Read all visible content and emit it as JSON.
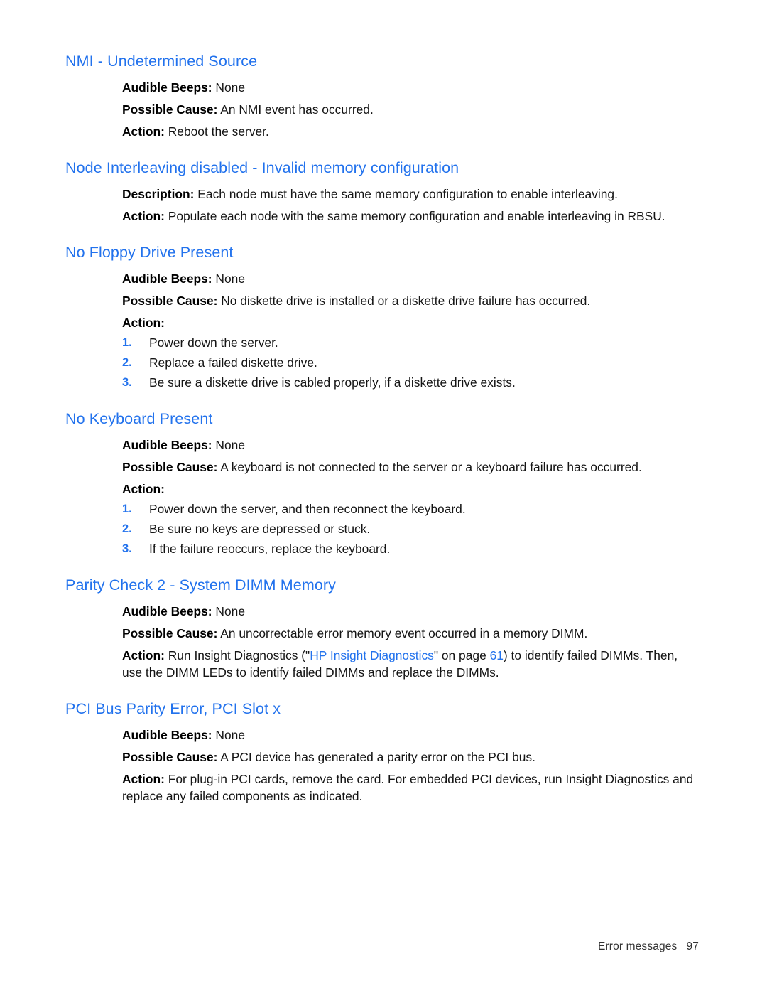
{
  "page": {
    "footer_label": "Error messages",
    "footer_page_number": "97",
    "heading_color": "#2272ED",
    "text_color": "#141414",
    "background_color": "#ffffff"
  },
  "labels": {
    "audible_beeps": "Audible Beeps",
    "possible_cause": "Possible Cause",
    "action": "Action",
    "description": "Description",
    "colon": ":"
  },
  "sections": [
    {
      "heading": "NMI - Undetermined Source",
      "audible_beeps_value": " None",
      "possible_cause_value": " An NMI event has occurred.",
      "action_value": " Reboot the server."
    },
    {
      "heading": "Node Interleaving disabled - Invalid memory configuration",
      "description_value": " Each node must have the same memory configuration to enable interleaving.",
      "action_value": " Populate each node with the same memory configuration and enable interleaving in RBSU."
    },
    {
      "heading": "No Floppy Drive Present",
      "audible_beeps_value": " None",
      "possible_cause_value": " No diskette drive is installed or a diskette drive failure has occurred.",
      "action_value": "",
      "steps": [
        {
          "num": "1.",
          "text": "Power down the server."
        },
        {
          "num": "2.",
          "text": "Replace a failed diskette drive."
        },
        {
          "num": "3.",
          "text": "Be sure a diskette drive is cabled properly, if a diskette drive exists."
        }
      ]
    },
    {
      "heading": "No Keyboard Present",
      "audible_beeps_value": " None",
      "possible_cause_value": " A keyboard is not connected to the server or a keyboard failure has occurred.",
      "action_value": "",
      "steps": [
        {
          "num": "1.",
          "text": "Power down the server, and then reconnect the keyboard."
        },
        {
          "num": "2.",
          "text": "Be sure no keys are depressed or stuck."
        },
        {
          "num": "3.",
          "text": "If the failure reoccurs, replace the keyboard."
        }
      ]
    },
    {
      "heading": "Parity Check 2 - System DIMM Memory",
      "audible_beeps_value": " None",
      "possible_cause_value": " An uncorrectable error memory event occurred in a memory DIMM.",
      "action_prefix": " Run Insight Diagnostics (\"",
      "action_xref_text": "HP Insight Diagnostics",
      "action_mid": "\" on page ",
      "action_xref_page": "61",
      "action_suffix": ") to identify failed DIMMs. Then, use the DIMM LEDs to identify failed DIMMs and replace the DIMMs."
    },
    {
      "heading": "PCI Bus Parity Error, PCI Slot x",
      "audible_beeps_value": " None",
      "possible_cause_value": " A PCI device has generated a parity error on the PCI bus.",
      "action_value": " For plug-in PCI cards, remove the card. For embedded PCI devices, run Insight Diagnostics and replace any failed components as indicated."
    }
  ]
}
